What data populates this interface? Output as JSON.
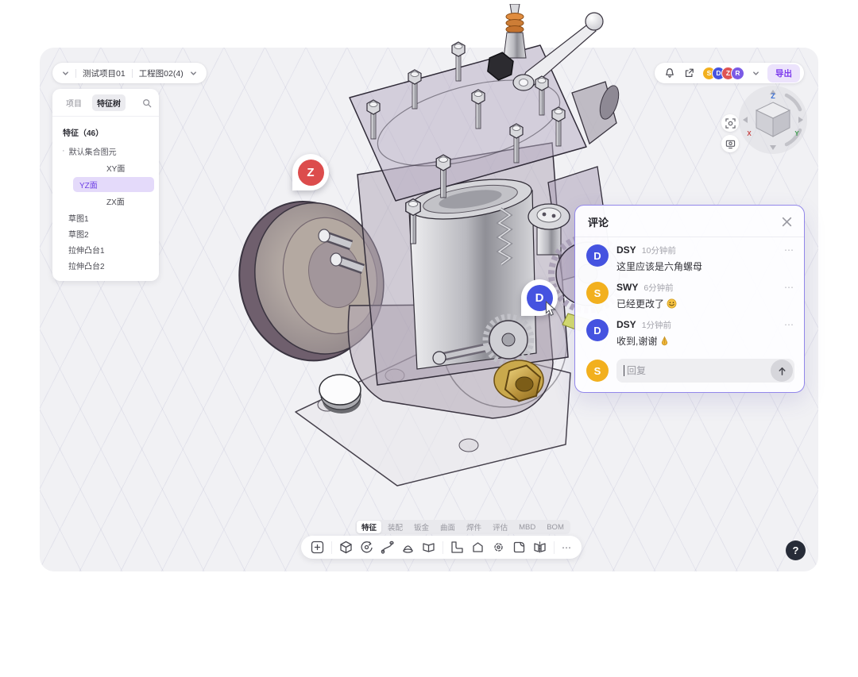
{
  "breadcrumb": {
    "project": "测试项目01",
    "document": "工程图02(4)"
  },
  "sidebar": {
    "tabs": [
      {
        "label": "项目",
        "active": false
      },
      {
        "label": "特征树",
        "active": true
      }
    ],
    "tree": {
      "header": "特征（46）",
      "items": [
        {
          "label": "默认集合图元",
          "level": 1
        },
        {
          "label": "XY面",
          "level": 2,
          "selected": false
        },
        {
          "label": "YZ面",
          "level": 2,
          "selected": true
        },
        {
          "label": "ZX面",
          "level": 2,
          "selected": false
        },
        {
          "label": "草图1",
          "level": 1
        },
        {
          "label": "草图2",
          "level": 1
        },
        {
          "label": "拉伸凸台1",
          "level": 1
        },
        {
          "label": "拉伸凸台2",
          "level": 1
        }
      ]
    }
  },
  "topbar": {
    "avatars": [
      {
        "initial": "S",
        "color": "#F2B01E"
      },
      {
        "initial": "D",
        "color": "#4553E0"
      },
      {
        "initial": "Z",
        "color": "#DF5453"
      },
      {
        "initial": "R",
        "color": "#7B5BE6"
      }
    ],
    "export_label": "导出"
  },
  "viewcube": {
    "axis_x": "X",
    "axis_y": "Y",
    "axis_z": "Z",
    "axis_colors": {
      "x": "#c84b4b",
      "y": "#3f9d4f",
      "z": "#3b6fd4"
    }
  },
  "markers": {
    "z": {
      "initial": "Z",
      "color": "#dc4c4c"
    },
    "d": {
      "initial": "D",
      "color": "#4553e0"
    }
  },
  "comments": {
    "title": "评论",
    "items": [
      {
        "initial": "D",
        "color": "#4553E0",
        "author": "DSY",
        "time": "10分钟前",
        "text": "这里应该是六角螺母",
        "emoji": ""
      },
      {
        "initial": "S",
        "color": "#F2B01E",
        "author": "SWY",
        "time": "6分钟前",
        "text": "已经更改了",
        "emoji": "smile"
      },
      {
        "initial": "D",
        "color": "#4553E0",
        "author": "DSY",
        "time": "1分钟前",
        "text": "收到,谢谢",
        "emoji": "pray"
      }
    ],
    "reply": {
      "avatar_initial": "S",
      "avatar_color": "#F2B01E",
      "placeholder": "回复"
    }
  },
  "bottom": {
    "tabs": [
      "特征",
      "装配",
      "钣金",
      "曲面",
      "焊件",
      "评估",
      "MBD",
      "BOM"
    ],
    "active_tab": "特征",
    "toolbar_icons": [
      "add",
      "extrude",
      "revolve",
      "sweep",
      "loft",
      "rib",
      "fillet",
      "chamfer",
      "pattern",
      "shell",
      "mirror",
      "more"
    ],
    "more_label": "⋯"
  },
  "help": {
    "label": "?"
  },
  "accent_color": "#7B5BE6"
}
